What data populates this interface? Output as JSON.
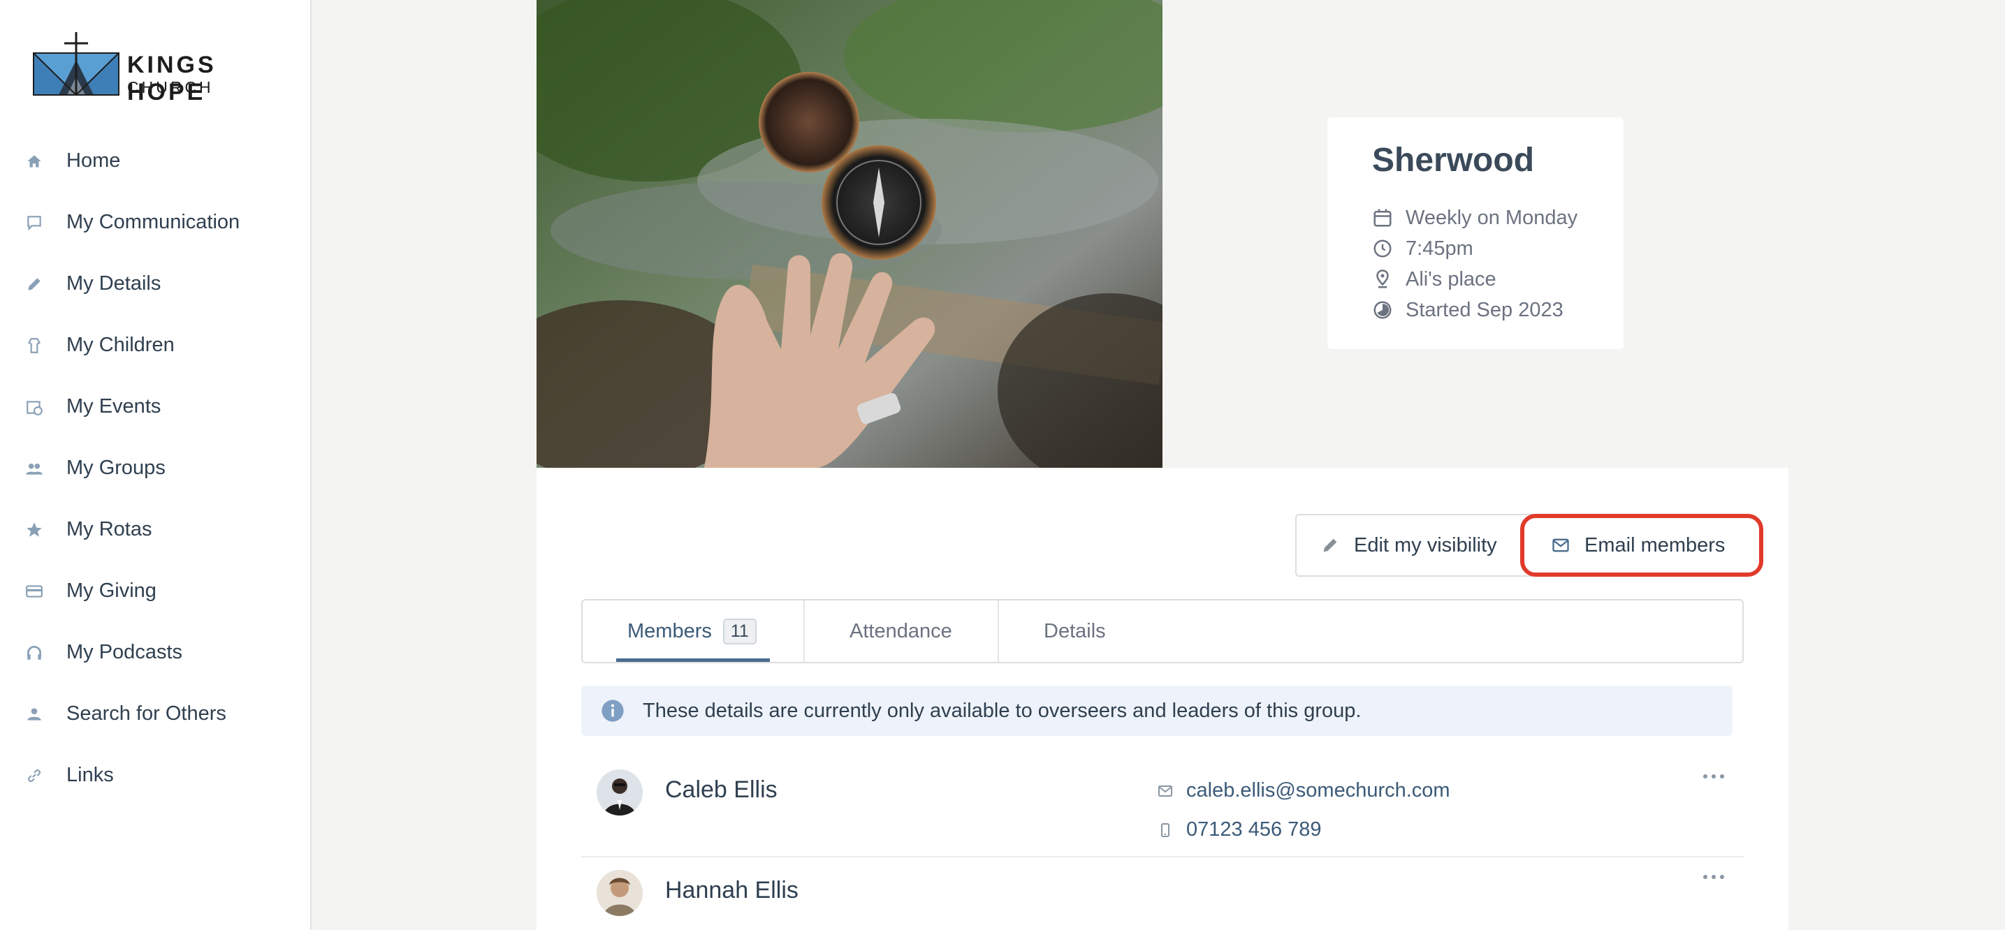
{
  "logo": {
    "line1": "KINGS HOPE",
    "line2": "CHURCH"
  },
  "sidebar": {
    "items": [
      {
        "label": "Home",
        "icon": "home-icon"
      },
      {
        "label": "My Communication",
        "icon": "message-icon"
      },
      {
        "label": "My Details",
        "icon": "pencil-icon"
      },
      {
        "label": "My Children",
        "icon": "child-icon"
      },
      {
        "label": "My Events",
        "icon": "calendar-clock-icon"
      },
      {
        "label": "My Groups",
        "icon": "people-icon"
      },
      {
        "label": "My Rotas",
        "icon": "star-icon"
      },
      {
        "label": "My Giving",
        "icon": "card-icon"
      },
      {
        "label": "My Podcasts",
        "icon": "headphones-icon"
      },
      {
        "label": "Search for Others",
        "icon": "person-search-icon"
      },
      {
        "label": "Links",
        "icon": "link-icon"
      }
    ]
  },
  "group": {
    "title": "Sherwood",
    "schedule": "Weekly on Monday",
    "time": "7:45pm",
    "location": "Ali's place",
    "started": "Started Sep 2023"
  },
  "actions": {
    "edit_visibility": "Edit my visibility",
    "email_members": "Email members"
  },
  "tabs": [
    {
      "label": "Members",
      "count": "11"
    },
    {
      "label": "Attendance"
    },
    {
      "label": "Details"
    }
  ],
  "notice": "These details are currently only available to overseers and leaders of this group.",
  "members": [
    {
      "name": "Caleb Ellis",
      "email": "caleb.ellis@somechurch.com",
      "phone": "07123 456 789"
    },
    {
      "name": "Hannah Ellis"
    }
  ],
  "colors": {
    "accent": "#4a6d8f",
    "highlight": "#e03a2b",
    "icon": "#8aa0b6"
  }
}
